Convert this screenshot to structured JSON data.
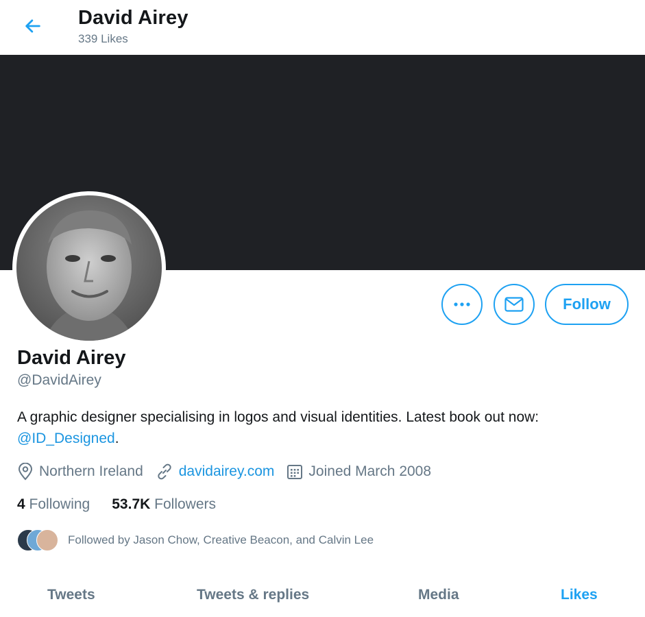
{
  "header": {
    "title": "David Airey",
    "subtitle": "339 Likes"
  },
  "profile": {
    "name": "David Airey",
    "handle": "@DavidAirey",
    "bio_text": "A graphic designer specialising in logos and visual identities. Latest book out now:",
    "bio_link": "@ID_Designed",
    "bio_end": ".",
    "location": "Northern Ireland",
    "website": "davidairey.com",
    "joined": "Joined March 2008"
  },
  "actions": {
    "follow_label": "Follow"
  },
  "stats": {
    "following_count": "4",
    "following_label": "Following",
    "followers_count": "53.7K",
    "followers_label": "Followers"
  },
  "followed_by": "Followed by Jason Chow, Creative Beacon, and Calvin Lee",
  "tabs": [
    {
      "label": "Tweets"
    },
    {
      "label": "Tweets & replies"
    },
    {
      "label": "Media"
    },
    {
      "label": "Likes"
    }
  ],
  "colors": {
    "accent": "#1da1f2",
    "banner": "#1f2125",
    "secondary_text": "#657786"
  },
  "icons": [
    "back-arrow-icon",
    "more-icon",
    "mail-icon",
    "location-icon",
    "link-icon",
    "calendar-icon"
  ]
}
